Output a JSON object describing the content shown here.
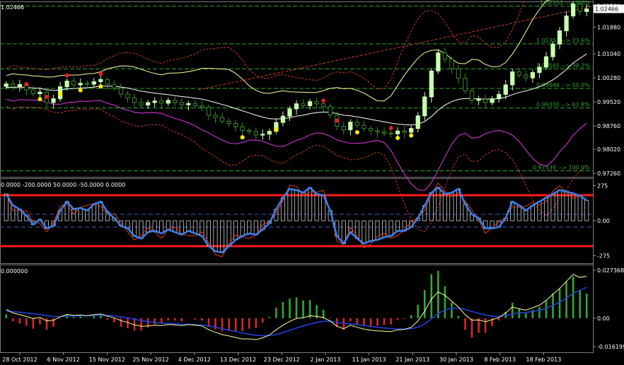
{
  "colors": {
    "background": "#000000",
    "bull_candle": "#c8ffb0",
    "bear_candle": "#3a8a2a",
    "bollinger": "#ffff99",
    "envelope": "#c83c28",
    "lower_band": "#c030c0",
    "fib": "#2ea82e",
    "cci_main": "#3a7fe8",
    "cci_signal": "#e03a1a",
    "cci_levels": "#ff1a1a",
    "macd_signal": "#ffff99",
    "macd_main": "#2040d8",
    "hist_pos": "#2ea82e",
    "hist_neg": "#d82828"
  },
  "main_panel": {
    "symbol_price": "1.02466",
    "current_price": "1.02466",
    "y_ticks": [
      "1.02560",
      "1.01880",
      "1.01040",
      "1.00280",
      "0.99520",
      "0.98760",
      "0.98020",
      "0.97260"
    ],
    "fib_levels": [
      {
        "price": 1.02551,
        "label": "1.02551 --> 0.0%"
      },
      {
        "price": 1.01357,
        "label": "1.01357 --> 23.6%"
      },
      {
        "price": 1.00565,
        "label": "1.00565 --> 38.2%"
      },
      {
        "price": 0.99946,
        "label": "0.99946 --> 50.0%"
      },
      {
        "price": 0.9933,
        "label": "0.99330 --> 61.8%"
      },
      {
        "price": 0.97339,
        "label": "0.97339 --> 100.0%"
      }
    ]
  },
  "cci_panel": {
    "header": "0.0000 -200.0000 50.0000 -50.0000 0.0000",
    "y_ticks": [
      "275",
      "0.00",
      "-275"
    ]
  },
  "macd_panel": {
    "header": "0.000000",
    "y_ticks": [
      "0.027368",
      "0.00",
      "-0.016199"
    ]
  },
  "x_ticks": [
    "28 Oct 2012",
    "6 Nov 2012",
    "15 Nov 2012",
    "25 Nov 2012",
    "4 Dec 2012",
    "13 Dec 2012",
    "23 Dec 2012",
    "2 Jan 2013",
    "11 Jan 2013",
    "21 Jan 2013",
    "30 Jan 2013",
    "8 Feb 2013",
    "18 Feb 2013"
  ],
  "chart_data": [
    {
      "type": "candlestick",
      "name": "EURCHF daily price",
      "ylim": [
        0.9715,
        1.027
      ],
      "close": [
        1.0009,
        1.0001,
        1.0007,
        0.999,
        0.9978,
        0.9983,
        0.995,
        0.9962,
        1.0,
        1.0018,
        1.0006,
        1.0011,
        1.0008,
        1.0016,
        1.0023,
        1.0008,
        0.9996,
        0.9977,
        0.9965,
        0.995,
        0.9942,
        0.995,
        0.9955,
        0.9948,
        0.9957,
        0.995,
        0.9943,
        0.9947,
        0.994,
        0.9935,
        0.991,
        0.9903,
        0.9891,
        0.9884,
        0.9873,
        0.9862,
        0.9858,
        0.9847,
        0.985,
        0.9859,
        0.9887,
        0.9907,
        0.993,
        0.9946,
        0.994,
        0.9953,
        0.9946,
        0.9938,
        0.991,
        0.9875,
        0.9864,
        0.9888,
        0.9878,
        0.9868,
        0.9861,
        0.9857,
        0.9853,
        0.9851,
        0.986,
        0.9856,
        0.9868,
        0.9908,
        0.9968,
        1.005,
        1.0107,
        1.0087,
        1.0057,
        1.0027,
        0.9987,
        0.9957,
        0.996,
        0.995,
        0.9962,
        0.9976,
        1.0006,
        1.0047,
        1.0037,
        1.0028,
        1.0045,
        1.0062,
        1.0095,
        1.0135,
        1.0177,
        1.0224,
        1.0262,
        1.0238,
        1.0246
      ],
      "ema": [
        0.9998,
        0.9998,
        0.9999,
        0.9998,
        0.9996,
        0.9995,
        0.9991,
        0.9988,
        0.999,
        0.9993,
        0.9994,
        0.9996,
        0.9997,
        0.9999,
        1.0002,
        1.0002,
        1.0002,
        0.9999,
        0.9996,
        0.9991,
        0.9986,
        0.9983,
        0.998,
        0.9977,
        0.9975,
        0.9972,
        0.9969,
        0.9967,
        0.9964,
        0.9961,
        0.9956,
        0.995,
        0.9944,
        0.9938,
        0.9931,
        0.9924,
        0.9917,
        0.991,
        0.9904,
        0.9899,
        0.9898,
        0.9899,
        0.9902,
        0.9907,
        0.991,
        0.9915,
        0.9918,
        0.992,
        0.9919,
        0.9915,
        0.991,
        0.9908,
        0.9905,
        0.9901,
        0.9897,
        0.9893,
        0.9889,
        0.9885,
        0.9882,
        0.988,
        0.9879,
        0.9882,
        0.989,
        0.9906,
        0.9926,
        0.9942,
        0.9953,
        0.996,
        0.9963,
        0.9962,
        0.9962,
        0.9961,
        0.9961,
        0.9963,
        0.9967,
        0.9975,
        0.9982,
        0.9987,
        0.9993,
        1.0,
        1.001,
        1.0022,
        1.0037,
        1.0055,
        1.0075,
        1.009,
        1.0104
      ],
      "cci": [
        210,
        120,
        90,
        40,
        -30,
        10,
        -60,
        -40,
        80,
        150,
        90,
        100,
        80,
        130,
        150,
        70,
        20,
        -40,
        -60,
        -120,
        -140,
        -90,
        -80,
        -100,
        -70,
        -90,
        -110,
        -80,
        -100,
        -120,
        -200,
        -240,
        -250,
        -200,
        -150,
        -120,
        -100,
        -110,
        -70,
        -20,
        90,
        180,
        250,
        240,
        220,
        260,
        210,
        200,
        80,
        -120,
        -180,
        -90,
        -140,
        -180,
        -160,
        -150,
        -130,
        -120,
        -80,
        -80,
        -50,
        20,
        120,
        220,
        260,
        210,
        220,
        250,
        130,
        50,
        20,
        -60,
        -60,
        -50,
        20,
        150,
        120,
        80,
        120,
        150,
        180,
        210,
        240,
        230,
        215,
        195,
        160
      ],
      "macd": [
        0.005,
        0.003,
        0.002,
        0.001,
        -0.0002,
        0.0005,
        -0.0015,
        -0.0012,
        0.0008,
        0.0022,
        0.0016,
        0.0018,
        0.0015,
        0.002,
        0.0024,
        0.0012,
        0.0002,
        -0.0014,
        -0.0024,
        -0.0038,
        -0.0046,
        -0.0044,
        -0.004,
        -0.0042,
        -0.0036,
        -0.0038,
        -0.0042,
        -0.0036,
        -0.004,
        -0.0044,
        -0.0066,
        -0.008,
        -0.0094,
        -0.0101,
        -0.011,
        -0.0118,
        -0.0118,
        -0.0122,
        -0.0112,
        -0.0096,
        -0.0066,
        -0.004,
        -0.0018,
        -0.0002,
        0.0002,
        0.0014,
        0.001,
        0.0004,
        -0.0016,
        -0.0046,
        -0.006,
        -0.004,
        -0.0052,
        -0.0062,
        -0.0068,
        -0.0072,
        -0.0074,
        -0.0076,
        -0.0066,
        -0.0064,
        -0.0052,
        -0.0016,
        0.004,
        0.011,
        0.015,
        0.013,
        0.0098,
        0.0064,
        0.002,
        -0.0012,
        -0.001,
        -0.002,
        -0.0008,
        0.0004,
        0.003,
        0.0064,
        0.0054,
        0.0046,
        0.006,
        0.0074,
        0.0102,
        0.0136,
        0.017,
        0.021,
        0.025,
        0.0232,
        0.024
      ],
      "macd_signal": [
        0.004,
        0.0038,
        0.0034,
        0.003,
        0.0025,
        0.0021,
        0.0015,
        0.001,
        0.0009,
        0.0012,
        0.0013,
        0.0014,
        0.0014,
        0.0015,
        0.0017,
        0.0016,
        0.0013,
        0.0008,
        0.0002,
        -0.0006,
        -0.0014,
        -0.002,
        -0.0024,
        -0.0028,
        -0.003,
        -0.0032,
        -0.0034,
        -0.0035,
        -0.0036,
        -0.0038,
        -0.0044,
        -0.0051,
        -0.006,
        -0.0068,
        -0.0076,
        -0.0085,
        -0.0091,
        -0.0097,
        -0.01,
        -0.0099,
        -0.0093,
        -0.0082,
        -0.0069,
        -0.0056,
        -0.0044,
        -0.0033,
        -0.0024,
        -0.0018,
        -0.0017,
        -0.0023,
        -0.003,
        -0.0032,
        -0.0036,
        -0.0041,
        -0.0047,
        -0.0052,
        -0.0056,
        -0.006,
        -0.0061,
        -0.0062,
        -0.006,
        -0.0051,
        -0.0033,
        -0.0004,
        0.0027,
        0.0047,
        0.0057,
        0.0058,
        0.005,
        0.0038,
        0.0028,
        0.0018,
        0.0012,
        0.001,
        0.0014,
        0.0024,
        0.003,
        0.0033,
        0.0038,
        0.0045,
        0.0056,
        0.0072,
        0.0092,
        0.0115,
        0.0142,
        0.016,
        0.0176
      ]
    }
  ]
}
